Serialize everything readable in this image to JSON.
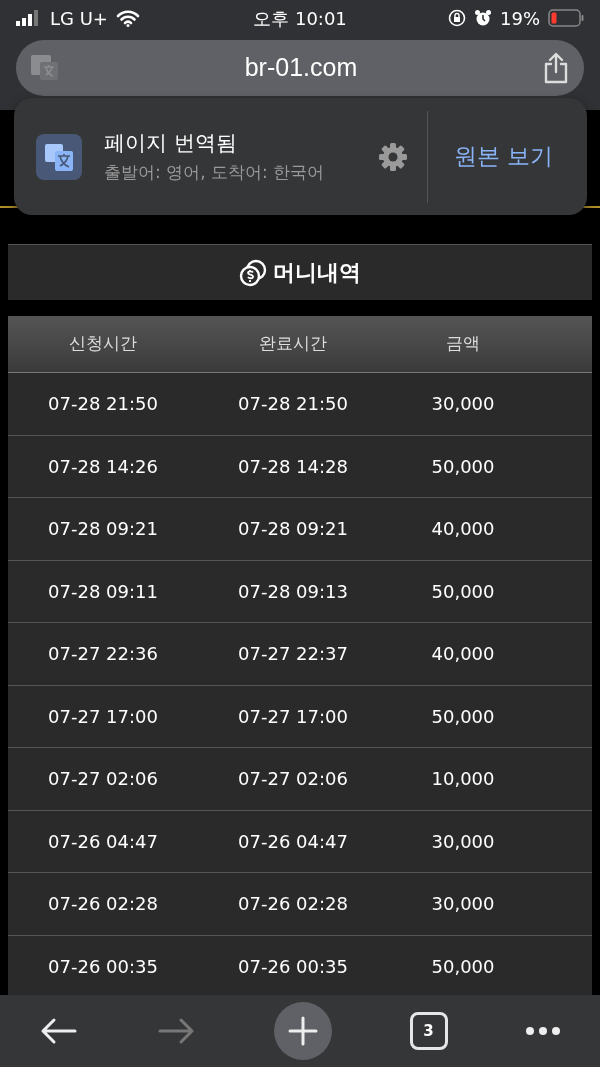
{
  "status_bar": {
    "carrier": "LG U+",
    "time": "오후 10:01",
    "battery": "19%"
  },
  "address_bar": {
    "url": "br-01.com"
  },
  "translate_popup": {
    "title": "페이지 번역됨",
    "subtitle": "출발어: 영어, 도착어: 한국어",
    "action": "원본 보기"
  },
  "section": {
    "title": "머니내역"
  },
  "table": {
    "columns": [
      "신청시간",
      "완료시간",
      "금액"
    ],
    "rows": [
      [
        "07-28 21:50",
        "07-28 21:50",
        "30,000"
      ],
      [
        "07-28 14:26",
        "07-28 14:28",
        "50,000"
      ],
      [
        "07-28 09:21",
        "07-28 09:21",
        "40,000"
      ],
      [
        "07-28 09:11",
        "07-28 09:13",
        "50,000"
      ],
      [
        "07-27 22:36",
        "07-27 22:37",
        "40,000"
      ],
      [
        "07-27 17:00",
        "07-27 17:00",
        "50,000"
      ],
      [
        "07-27 02:06",
        "07-27 02:06",
        "10,000"
      ],
      [
        "07-26 04:47",
        "07-26 04:47",
        "30,000"
      ],
      [
        "07-26 02:28",
        "07-26 02:28",
        "30,000"
      ],
      [
        "07-26 00:35",
        "07-26 00:35",
        "50,000"
      ]
    ]
  },
  "toolbar": {
    "back_disabled": false,
    "forward_disabled": true,
    "tab_count": "3"
  }
}
